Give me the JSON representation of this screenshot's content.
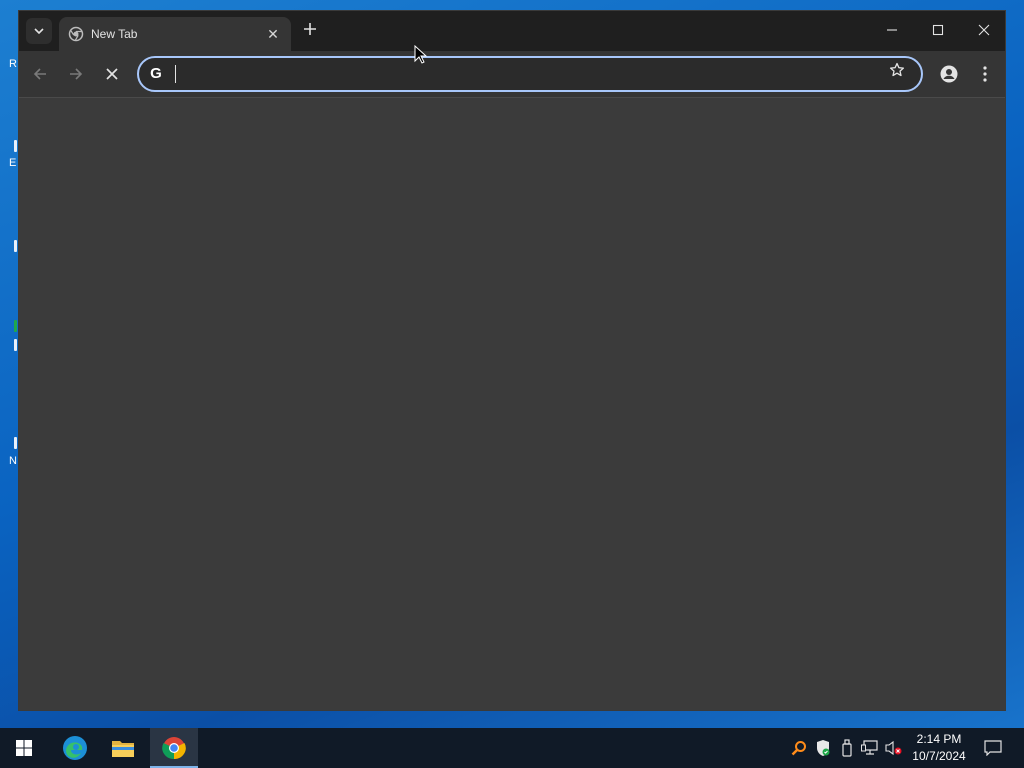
{
  "desktop": {
    "peek_letters": [
      "R",
      "E",
      "N"
    ]
  },
  "browser": {
    "tab": {
      "title": "New Tab",
      "favicon": "chrome-newtab-icon"
    },
    "omnibox": {
      "value": "",
      "search_engine_icon": "google-g-icon"
    },
    "accent_color": "#a8c7fa",
    "content_color": "#3b3b3b"
  },
  "taskbar": {
    "apps": [
      "start-icon",
      "edge-icon",
      "file-explorer-icon",
      "chrome-icon"
    ],
    "active_app": "chrome-icon",
    "clock": {
      "time": "2:14 PM",
      "date": "10/7/2024"
    }
  }
}
